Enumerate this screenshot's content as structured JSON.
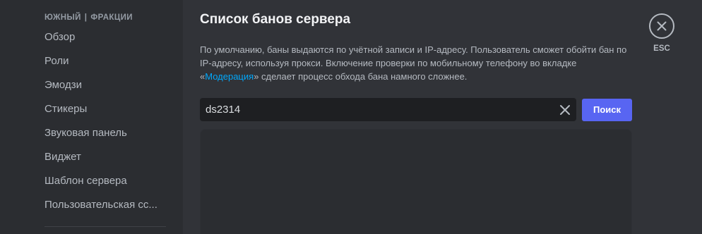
{
  "sidebar": {
    "server_name": "ЮЖНЫЙ",
    "separator": "|",
    "section": "ФРАКЦИИ",
    "items": [
      {
        "label": "Обзор"
      },
      {
        "label": "Роли"
      },
      {
        "label": "Эмодзи"
      },
      {
        "label": "Стикеры"
      },
      {
        "label": "Звуковая панель"
      },
      {
        "label": "Виджет"
      },
      {
        "label": "Шаблон сервера"
      },
      {
        "label": "Пользовательская сс..."
      }
    ]
  },
  "main": {
    "title": "Список банов сервера",
    "description_part1": "По умолчанию, баны выдаются по учётной записи и IP-адресу. Пользователь сможет обойти бан по IP-адресу, используя прокси. Включение проверки по мобильному телефону во вкладке «",
    "description_link": "Модерация",
    "description_part2": "» сделает процесс обхода бана намного сложнее.",
    "search": {
      "value": "ds2314",
      "button_label": "Поиск"
    }
  },
  "close": {
    "label": "ESC",
    "icon": "close-icon"
  },
  "colors": {
    "accent": "#5865f2",
    "link": "#00a8fc",
    "sidebar_bg": "#2b2d31",
    "content_bg": "#313338",
    "input_bg": "#1e1f22"
  }
}
